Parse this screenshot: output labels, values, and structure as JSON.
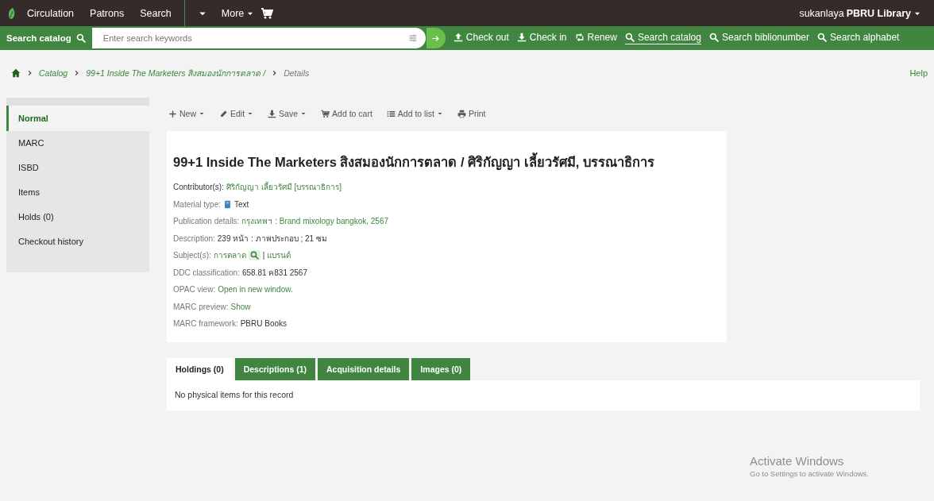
{
  "top_nav": {
    "items": [
      {
        "label": "Circulation"
      },
      {
        "label": "Patrons"
      },
      {
        "label": "Search"
      }
    ],
    "more": "More",
    "user": "sukanlaya",
    "branch": "PBRU Library"
  },
  "search_bar": {
    "label": "Search catalog",
    "placeholder": "Enter search keywords",
    "links": [
      {
        "label": "Check out",
        "selected": false
      },
      {
        "label": "Check in",
        "selected": false
      },
      {
        "label": "Renew",
        "selected": false
      },
      {
        "label": "Search catalog",
        "selected": true
      },
      {
        "label": "Search biblionumber",
        "selected": false
      },
      {
        "label": "Search alphabet",
        "selected": false
      }
    ]
  },
  "breadcrumb": {
    "items": [
      "Catalog",
      "99+1 Inside The Marketers สิงสมองนักการตลาด /",
      "Details"
    ],
    "help": "Help"
  },
  "sidebar": {
    "items": [
      {
        "label": "Normal",
        "selected": true
      },
      {
        "label": "MARC",
        "selected": false
      },
      {
        "label": "ISBD",
        "selected": false
      },
      {
        "label": "Items",
        "selected": false
      },
      {
        "label": "Holds (0)",
        "selected": false
      },
      {
        "label": "Checkout history",
        "selected": false
      }
    ]
  },
  "toolbar": [
    {
      "label": "New",
      "dropdown": true
    },
    {
      "label": "Edit",
      "dropdown": true
    },
    {
      "label": "Save",
      "dropdown": true
    },
    {
      "label": "Add to cart",
      "dropdown": false
    },
    {
      "label": "Add to list",
      "dropdown": true
    },
    {
      "label": "Print",
      "dropdown": false
    }
  ],
  "record": {
    "title": "99+1 Inside The Marketers สิงสมองนักการตลาด / ศิริกัญญา เลี้ยวรัศมี, บรรณาธิการ",
    "fields": [
      {
        "kind": "link",
        "label": "Contributor(s):",
        "value": "ศิริกัญญา เลี้ยวรัศมี [บรรณาธิการ]",
        "strong_label": true
      },
      {
        "kind": "type",
        "label": "Material type:",
        "value": "Text",
        "strong_label": false
      },
      {
        "kind": "link",
        "label": "Publication details:",
        "value": "กรุงเทพฯ : Brand mixology bangkok, 2567",
        "strong_label": false
      },
      {
        "kind": "plain",
        "label": "Description:",
        "value": "239 หน้า : ภาพประกอบ ; 21 ซม",
        "strong_label": false
      },
      {
        "kind": "subjects",
        "label": "Subject(s):",
        "values": [
          "การตลาด",
          "แบรนด์"
        ],
        "separator": "|",
        "strong_label": false
      },
      {
        "kind": "plain",
        "label": "DDC classification:",
        "value": "658.81 ค831 2567",
        "strong_label": false
      },
      {
        "kind": "link",
        "label": "OPAC view:",
        "value": "Open in new window.",
        "strong_label": false
      },
      {
        "kind": "link",
        "label": "MARC preview:",
        "value": "Show",
        "strong_label": false
      },
      {
        "kind": "plain",
        "label": "MARC framework:",
        "value": "PBRU Books",
        "strong_label": false
      }
    ]
  },
  "tabs": [
    {
      "label": "Holdings (0)",
      "selected": true
    },
    {
      "label": "Descriptions (1)",
      "selected": false
    },
    {
      "label": "Acquisition details",
      "selected": false
    },
    {
      "label": "Images (0)",
      "selected": false
    }
  ],
  "tab_content": "No physical items for this record",
  "os_notice": {
    "title": "Activate Windows",
    "subtitle": "Go to Settings to activate Windows."
  }
}
